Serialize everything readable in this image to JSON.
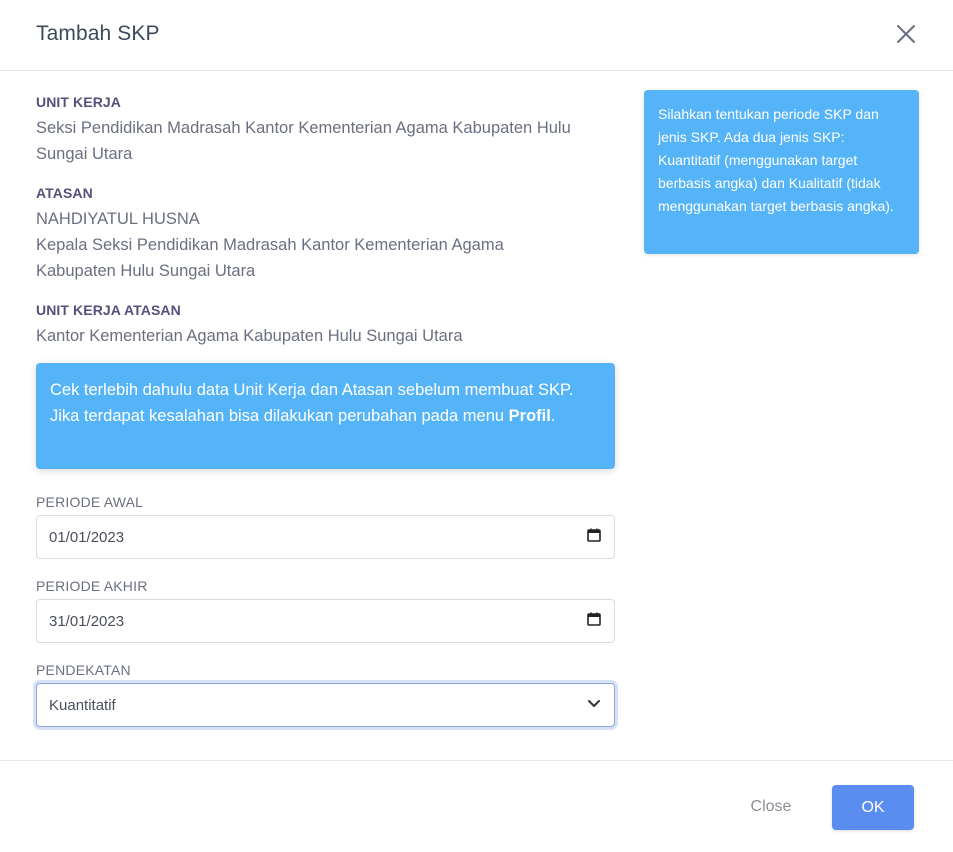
{
  "modal": {
    "title": "Tambah SKP"
  },
  "info": {
    "unit_kerja_label": "UNIT KERJA",
    "unit_kerja_value": "Seksi Pendidikan Madrasah Kantor Kementerian Agama Kabupaten Hulu Sungai Utara",
    "atasan_label": "ATASAN",
    "atasan_name": "NAHDIYATUL HUSNA",
    "atasan_position": "Kepala Seksi Pendidikan Madrasah Kantor Kementerian Agama Kabupaten Hulu Sungai Utara",
    "unit_kerja_atasan_label": "UNIT KERJA ATASAN",
    "unit_kerja_atasan_value": "Kantor Kementerian Agama Kabupaten Hulu Sungai Utara"
  },
  "alert_left": {
    "text": "Cek terlebih dahulu data Unit Kerja dan Atasan sebelum membuat SKP. Jika terdapat kesalahan bisa dilakukan perubahan pada menu ",
    "bold": "Profil",
    "end": "."
  },
  "alert_right": {
    "text": "Silahkan tentukan periode SKP dan jenis SKP. Ada dua jenis SKP: Kuantitatif (menggunakan target berbasis angka) dan Kualitatif (tidak menggunakan target berbasis angka)."
  },
  "form": {
    "periode_awal_label": "PERIODE AWAL",
    "periode_awal_value": "01/01/2023",
    "periode_akhir_label": "PERIODE AKHIR",
    "periode_akhir_value": "31/01/2023",
    "pendekatan_label": "PENDEKATAN",
    "pendekatan_value": "Kuantitatif"
  },
  "footer": {
    "close_label": "Close",
    "ok_label": "OK"
  },
  "icons": {
    "close": "close-icon",
    "calendar": "calendar-icon",
    "chevron": "chevron-down-icon"
  },
  "colors": {
    "alert_bg": "#55b3f7",
    "ok_button": "#5b8df0",
    "label": "#58507a"
  }
}
